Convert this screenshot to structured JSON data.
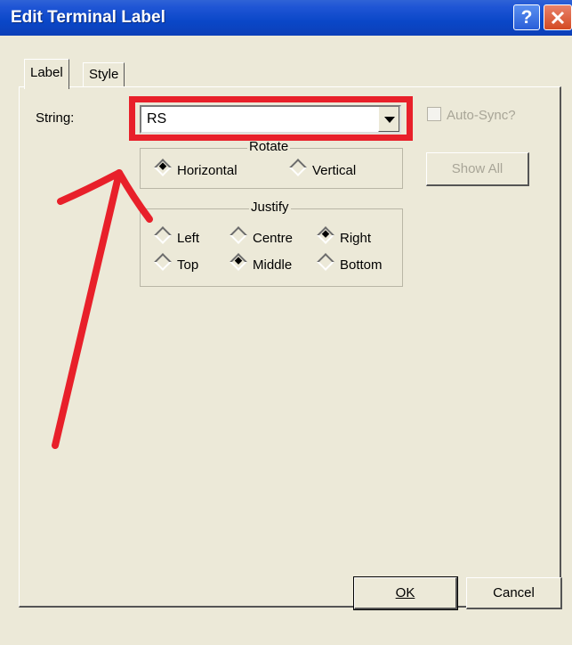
{
  "window": {
    "title": "Edit Terminal Label",
    "help_icon": "help-icon",
    "close_icon": "close-icon"
  },
  "tabs": [
    {
      "label": "Label",
      "active": true
    },
    {
      "label": "Style",
      "active": false
    }
  ],
  "string_field": {
    "label": "String:",
    "value": "RS"
  },
  "auto_sync": {
    "label": "Auto-Sync?",
    "checked": false,
    "enabled": false
  },
  "show_all": {
    "label": "Show All",
    "enabled": false
  },
  "rotate": {
    "legend": "Rotate",
    "options": [
      {
        "label": "Horizontal",
        "selected": true
      },
      {
        "label": "Vertical",
        "selected": false
      }
    ]
  },
  "justify": {
    "legend": "Justify",
    "options": [
      {
        "label": "Left",
        "selected": false
      },
      {
        "label": "Centre",
        "selected": false
      },
      {
        "label": "Right",
        "selected": true
      },
      {
        "label": "Top",
        "selected": false
      },
      {
        "label": "Middle",
        "selected": true
      },
      {
        "label": "Bottom",
        "selected": false
      }
    ]
  },
  "buttons": {
    "ok": "OK",
    "cancel": "Cancel"
  },
  "annotation_color": "#e8202a"
}
